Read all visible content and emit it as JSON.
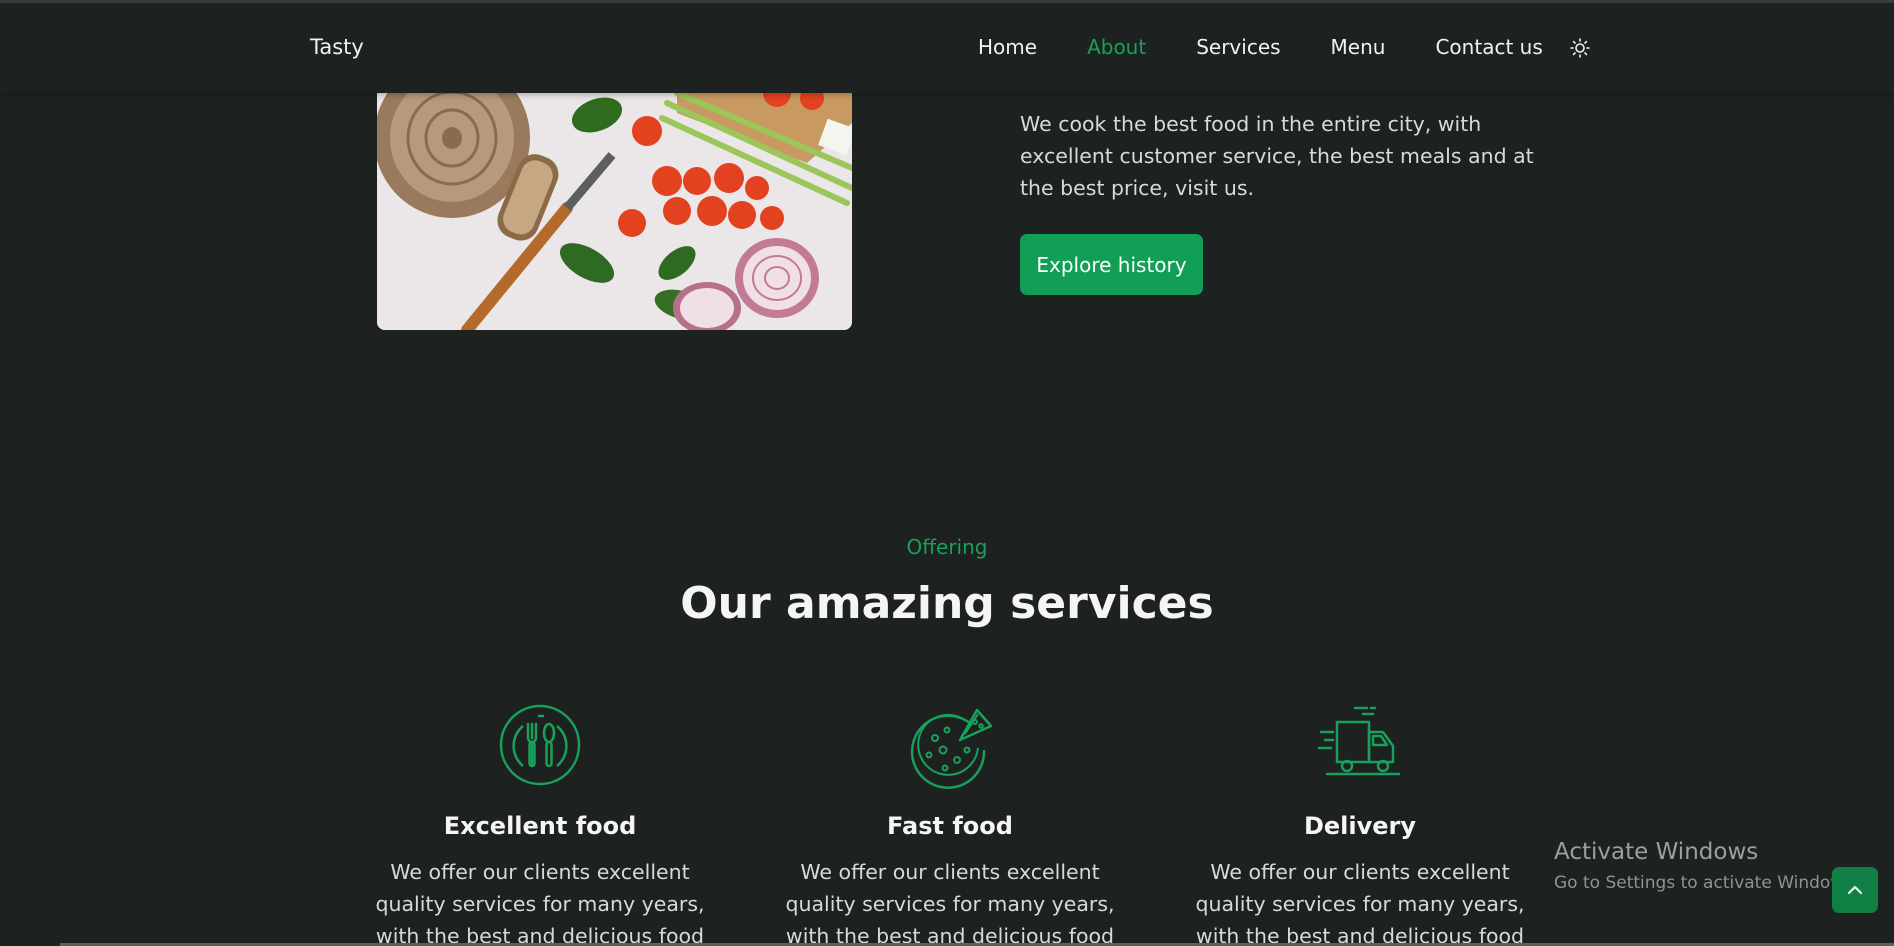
{
  "header": {
    "logo": "Tasty",
    "nav": [
      {
        "label": "Home",
        "active": false
      },
      {
        "label": "About",
        "active": true
      },
      {
        "label": "Services",
        "active": false
      },
      {
        "label": "Menu",
        "active": false
      },
      {
        "label": "Contact us",
        "active": false
      }
    ],
    "theme_icon": "sun-icon"
  },
  "about": {
    "image": "bread-tomatoes-onion-photo",
    "description": "We cook the best food in the entire city, with excellent customer service, the best meals and at the best price, visit us.",
    "button_label": "Explore history"
  },
  "services": {
    "subtitle": "Offering",
    "title": "Our amazing services",
    "cards": [
      {
        "icon": "fork-spoon-plate-icon",
        "title": "Excellent food",
        "text": "We offer our clients excellent quality services for many years, with the best and delicious food"
      },
      {
        "icon": "pizza-icon",
        "title": "Fast food",
        "text": "We offer our clients excellent quality services for many years, with the best and delicious food"
      },
      {
        "icon": "delivery-truck-icon",
        "title": "Delivery",
        "text": "We offer our clients excellent quality services for many years, with the best and delicious food"
      }
    ]
  },
  "watermark": {
    "title": "Activate Windows",
    "subtitle": "Go to Settings to activate Windows."
  },
  "scroll_up_icon": "chevron-up-icon",
  "colors": {
    "background": "#1d211f",
    "accent": "#109f54",
    "text": "#f2f2f2"
  }
}
